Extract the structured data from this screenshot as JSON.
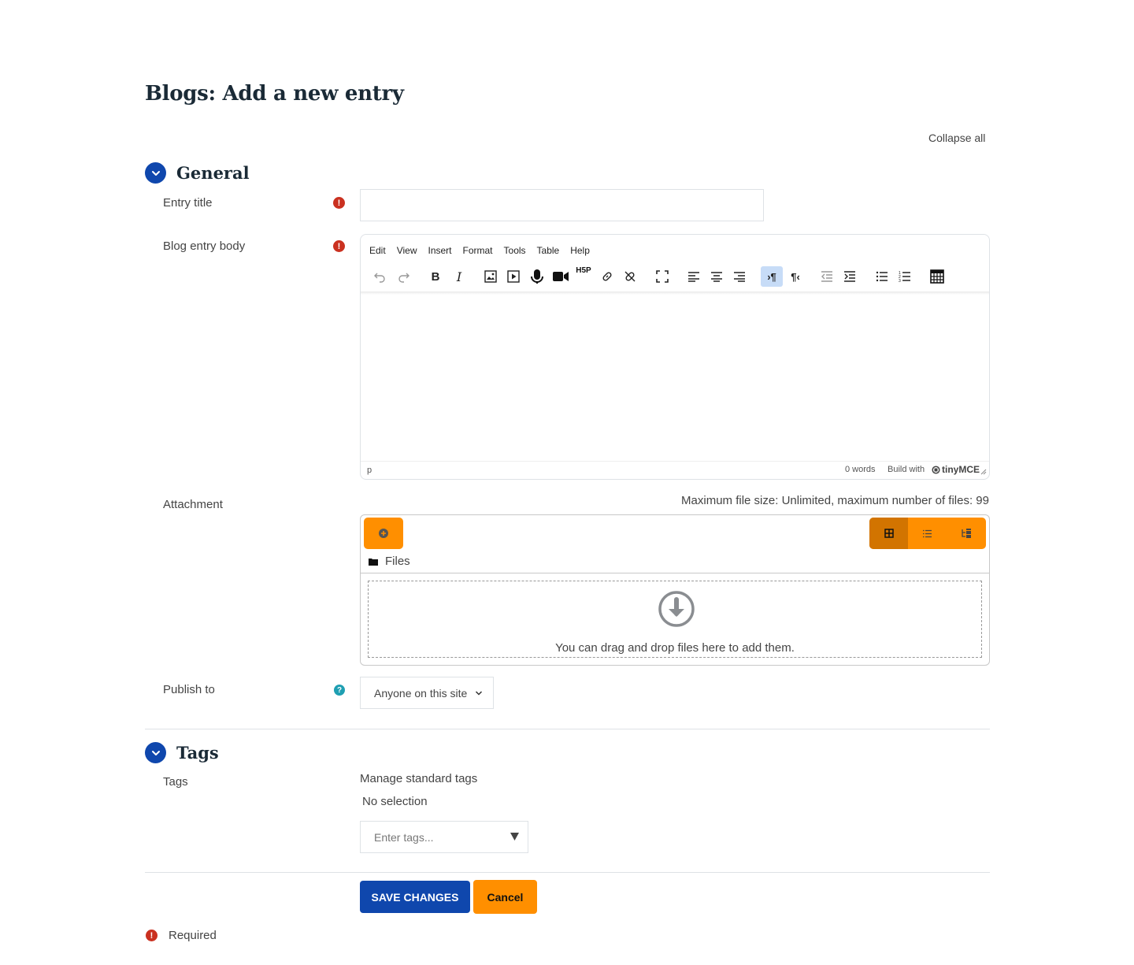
{
  "page": {
    "title": "Blogs: Add a new entry",
    "collapse_all": "Collapse all"
  },
  "general": {
    "heading": "General",
    "entry_title_label": "Entry title",
    "entry_title_value": "",
    "body_label": "Blog entry body",
    "editor": {
      "menus": [
        "Edit",
        "View",
        "Insert",
        "Format",
        "Tools",
        "Table",
        "Help"
      ],
      "status_path": "p",
      "word_count": "0 words",
      "build_with": "Build with",
      "brand": "tinyMCE",
      "h5p_label": "H5P"
    },
    "attachment_label": "Attachment",
    "attachment_info": "Maximum file size: Unlimited, maximum number of files: 99",
    "files_path": "Files",
    "drop_text": "You can drag and drop files here to add them.",
    "publish_label": "Publish to",
    "publish_value": "Anyone on this site"
  },
  "tags": {
    "heading": "Tags",
    "label": "Tags",
    "manage": "Manage standard tags",
    "selection": "No selection",
    "placeholder": "Enter tags..."
  },
  "actions": {
    "save": "SAVE CHANGES",
    "cancel": "Cancel"
  },
  "footer": {
    "required": "Required"
  },
  "colors": {
    "primary": "#0f47ad",
    "accent": "#ff8f00",
    "danger": "#ca3120",
    "info": "#1f9fb2"
  }
}
